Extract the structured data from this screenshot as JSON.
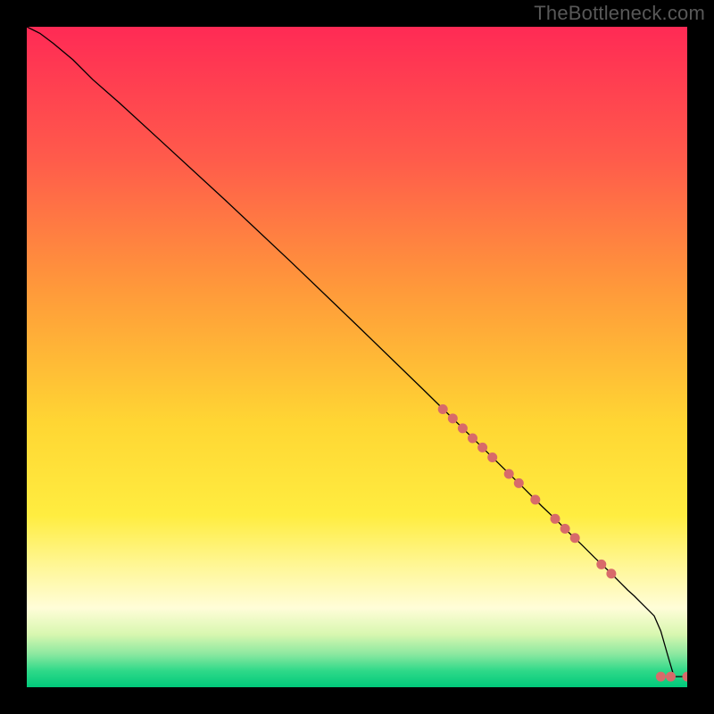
{
  "watermark": "TheBottleneck.com",
  "chart_data": {
    "type": "line",
    "title": "",
    "xlabel": "",
    "ylabel": "",
    "xlim": [
      0,
      100
    ],
    "ylim": [
      0,
      100
    ],
    "grid": false,
    "background_gradient": {
      "stops": [
        {
          "pos": 0.0,
          "color": "#ff2a55"
        },
        {
          "pos": 0.2,
          "color": "#ff5b4b"
        },
        {
          "pos": 0.4,
          "color": "#ff9a3a"
        },
        {
          "pos": 0.6,
          "color": "#ffd633"
        },
        {
          "pos": 0.74,
          "color": "#ffed40"
        },
        {
          "pos": 0.82,
          "color": "#fff79a"
        },
        {
          "pos": 0.88,
          "color": "#fffdd8"
        },
        {
          "pos": 0.92,
          "color": "#d8f7b0"
        },
        {
          "pos": 0.95,
          "color": "#8be8a0"
        },
        {
          "pos": 0.975,
          "color": "#2fd989"
        },
        {
          "pos": 1.0,
          "color": "#00c97a"
        }
      ]
    },
    "series": [
      {
        "name": "curve",
        "color": "#000000",
        "width": 1.3,
        "x": [
          0,
          2,
          4,
          7,
          10,
          14,
          20,
          30,
          40,
          50,
          60,
          65,
          70,
          75,
          78,
          80,
          82,
          84,
          86,
          88,
          90,
          91,
          92,
          93,
          94,
          95,
          96,
          97,
          98,
          100
        ],
        "y": [
          100,
          99,
          97.5,
          95,
          92,
          88.5,
          83,
          73.8,
          64.4,
          54.8,
          45.1,
          40.2,
          35.3,
          30.4,
          27.4,
          25.5,
          23.5,
          21.6,
          19.6,
          17.7,
          15.7,
          14.7,
          13.8,
          12.8,
          11.8,
          10.8,
          8.5,
          5.0,
          1.6,
          1.6
        ]
      },
      {
        "name": "dots",
        "color": "#d86a6a",
        "radius": 5.5,
        "x": [
          63,
          64.5,
          66,
          67.5,
          69,
          70.5,
          73,
          74.5,
          77,
          80,
          81.5,
          83,
          87,
          88.5,
          96,
          97.5,
          100
        ],
        "y": [
          42.1,
          40.7,
          39.2,
          37.7,
          36.3,
          34.8,
          32.3,
          30.9,
          28.4,
          25.5,
          24.0,
          22.6,
          18.6,
          17.2,
          1.6,
          1.6,
          1.6
        ]
      }
    ]
  }
}
